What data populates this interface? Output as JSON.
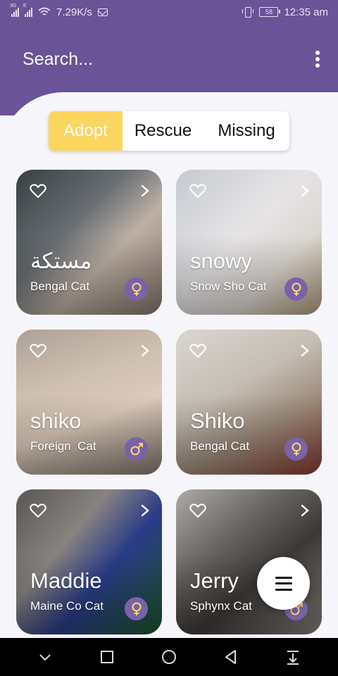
{
  "status_bar": {
    "sim1": "3G",
    "sim2": "E",
    "net_speed": "7.29K/s",
    "battery_level": "58",
    "time": "12:35 am",
    "icons": [
      "signal-icon",
      "wifi-icon",
      "mail-icon",
      "vibrate-icon",
      "battery-icon"
    ]
  },
  "header": {
    "search_label": "Search...",
    "menu_icon": "overflow-menu-icon"
  },
  "segments": {
    "options": [
      "Adopt",
      "Rescue",
      "Missing"
    ],
    "selected": "Adopt"
  },
  "cards": [
    {
      "name": "مستكة",
      "breed": "Bengal Cat",
      "gender": "female",
      "favorite": false
    },
    {
      "name": "snowy",
      "breed": "Snow Sho Cat",
      "gender": "female",
      "favorite": false
    },
    {
      "name": "shiko",
      "breed": "Foreign  Cat",
      "gender": "male",
      "favorite": false
    },
    {
      "name": "Shiko",
      "breed": "Bengal Cat",
      "gender": "female",
      "favorite": false
    },
    {
      "name": "Maddie",
      "breed": "Maine Co Cat",
      "gender": "female",
      "favorite": false
    },
    {
      "name": "Jerry",
      "breed": "Sphynx Cat",
      "gender": "male",
      "favorite": false
    }
  ],
  "fab": {
    "icon": "menu-icon"
  },
  "nav_bar": {
    "icons": [
      "collapse-icon",
      "recents-icon",
      "home-icon",
      "back-icon",
      "notification-pull-icon"
    ]
  },
  "colors": {
    "primary": "#6a5397",
    "accent": "#fcd55f",
    "badge": "#7a62a8",
    "background": "#f6f6fa"
  }
}
